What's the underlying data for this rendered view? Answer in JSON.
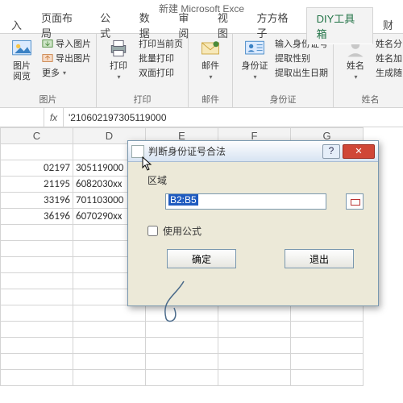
{
  "title": "新建 Microsoft Exce",
  "tabs": [
    "入",
    "页面布局",
    "公式",
    "数据",
    "审阅",
    "视图",
    "方方格子",
    "DIY工具箱",
    "财"
  ],
  "active_tab_index": 7,
  "ribbon": {
    "g1": {
      "big": "图片\n阅览",
      "s1": "导入图片",
      "s2": "导出图片",
      "s3": "更多",
      "label": "图片"
    },
    "g2": {
      "big": "打印",
      "s1": "打印当前页",
      "s2": "批量打印",
      "s3": "双面打印",
      "label": "打印"
    },
    "g3": {
      "big": "邮件",
      "label": "邮件"
    },
    "g4": {
      "big": "身份证",
      "s1": "输入身份证号",
      "s2": "提取性别",
      "s3": "提取出生日期",
      "label": "身份证"
    },
    "g5": {
      "big": "姓名",
      "s1": "姓名分",
      "s2": "姓名加",
      "s3": "生成随",
      "label": "姓名"
    }
  },
  "formula_bar": {
    "name": "",
    "fx": "fx",
    "value": "'210602197305119000"
  },
  "headers": [
    "",
    "C",
    "D",
    "E",
    "F",
    "G"
  ],
  "rows": [
    [
      "",
      "",
      "",
      "",
      "",
      ""
    ],
    [
      "02197",
      "305119000",
      "",
      "",
      "",
      ""
    ],
    [
      "21195",
      "6082030xx",
      "",
      "",
      "",
      ""
    ],
    [
      "33196",
      "701103000",
      "",
      "",
      "",
      ""
    ],
    [
      "36196",
      "6070290xx",
      "",
      "",
      "",
      ""
    ]
  ],
  "dialog": {
    "title": "判断身份证号合法",
    "area_label": "区域",
    "range_value": "B2:B5",
    "use_formula": "使用公式",
    "ok": "确定",
    "cancel": "退出"
  }
}
